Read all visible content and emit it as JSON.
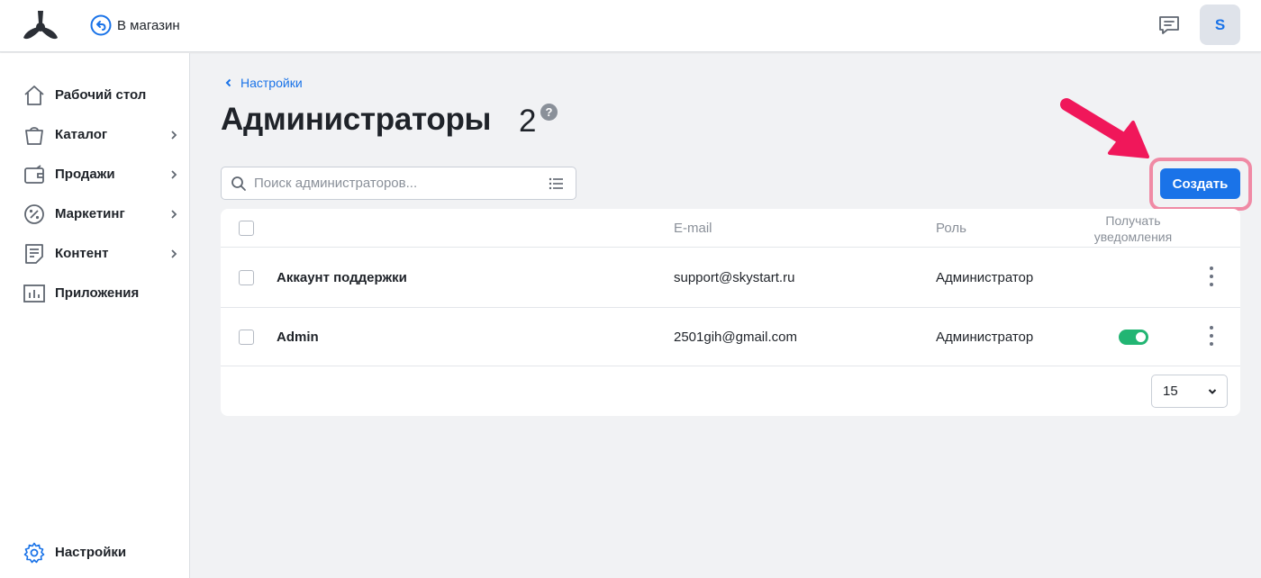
{
  "header": {
    "back_to_store": "В магазин",
    "user_initial": "S"
  },
  "sidebar": {
    "items": [
      {
        "label": "Рабочий стол",
        "icon": "home-icon",
        "has_submenu": false
      },
      {
        "label": "Каталог",
        "icon": "shopping-bag-icon",
        "has_submenu": true
      },
      {
        "label": "Продажи",
        "icon": "wallet-icon",
        "has_submenu": true
      },
      {
        "label": "Маркетинг",
        "icon": "percent-icon",
        "has_submenu": true
      },
      {
        "label": "Контент",
        "icon": "document-icon",
        "has_submenu": true
      },
      {
        "label": "Приложения",
        "icon": "chart-icon",
        "has_submenu": false
      }
    ],
    "footer_item": {
      "label": "Настройки",
      "icon": "gear-icon"
    }
  },
  "main": {
    "breadcrumb": "Настройки",
    "title": "Администраторы",
    "count": "2",
    "help": "?",
    "search_placeholder": "Поиск администраторов...",
    "create_label": "Создать",
    "table": {
      "columns": [
        "",
        "",
        "E-mail",
        "Роль",
        "Получать уведомления",
        ""
      ],
      "rows": [
        {
          "name": "Аккаунт поддержки",
          "email": "support@skystart.ru",
          "role": "Администратор",
          "notifications": false
        },
        {
          "name": "Admin",
          "email": "2501gih@gmail.com",
          "role": "Администратор",
          "notifications": true
        }
      ]
    },
    "per_page": "15"
  },
  "colors": {
    "accent": "#1a73e8",
    "toggle_on": "#22b573",
    "highlight": "#f08aa5",
    "arrow": "#f0175a"
  }
}
